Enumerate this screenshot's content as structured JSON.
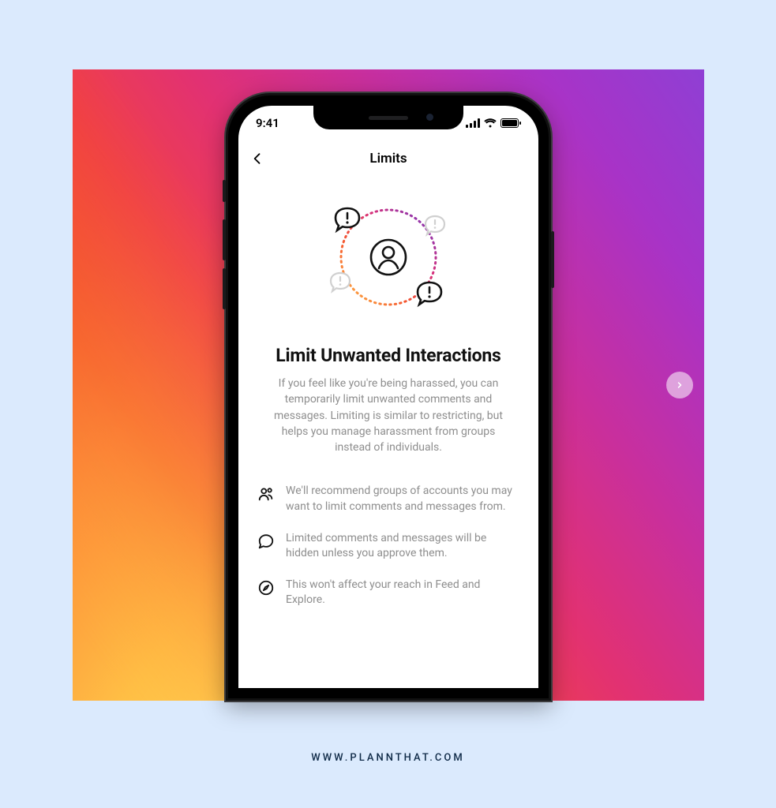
{
  "status_bar": {
    "time": "9:41"
  },
  "nav": {
    "title": "Limits"
  },
  "content": {
    "headline": "Limit Unwanted Interactions",
    "subtext": "If you feel like you're being harassed, you can temporarily limit unwanted comments and messages. Limiting is similar to restricting, but helps you manage harassment from groups instead of individuals.",
    "bullets": [
      {
        "icon": "people-icon",
        "text": "We'll recommend groups of accounts you may want to limit comments and messages from."
      },
      {
        "icon": "comment-icon",
        "text": "Limited comments and messages will be hidden unless you approve them."
      },
      {
        "icon": "compass-icon",
        "text": "This won't affect your reach in Feed and Explore."
      }
    ]
  },
  "footer": {
    "url": "WWW.PLANNTHAT.COM"
  }
}
